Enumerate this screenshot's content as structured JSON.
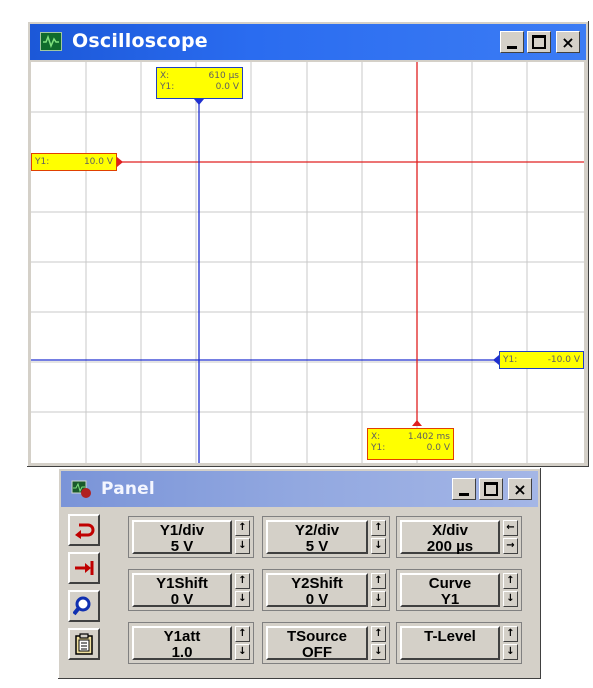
{
  "oscilloscope": {
    "title": "Oscilloscope",
    "controls": {
      "minimize": "_",
      "maximize": "□",
      "close": "×"
    },
    "cursor1": {
      "x_label": "X:",
      "x_value": "610 µs",
      "y_label": "Y1:",
      "y_value": "0.0 V"
    },
    "cursor2": {
      "x_label": "X:",
      "x_value": "1.402 ms",
      "y_label": "Y1:",
      "y_value": "0.0 V"
    },
    "hline_top": {
      "label": "Y1:",
      "value": "10.0 V"
    },
    "hline_bottom": {
      "label": "Y1:",
      "value": "-10.0 V"
    },
    "colors": {
      "grid": "#c0c0c0",
      "blue_line": "#2030d0",
      "red_line": "#e02020",
      "label_bg": "#ffff00"
    }
  },
  "panel": {
    "title": "Panel",
    "controls": {
      "minimize": "_",
      "maximize": "□",
      "close": "×"
    },
    "tools": [
      {
        "name": "loop-icon",
        "glyph": "↺"
      },
      {
        "name": "step-icon",
        "glyph": "→|"
      },
      {
        "name": "zoom-icon",
        "glyph": "🔍"
      },
      {
        "name": "clipboard-icon",
        "glyph": "📋"
      }
    ],
    "knobs": [
      {
        "label": "Y1/div",
        "value": "5 V",
        "spin_up": "↑",
        "spin_down": "↓"
      },
      {
        "label": "Y2/div",
        "value": "5 V",
        "spin_up": "↑",
        "spin_down": "↓"
      },
      {
        "label": "X/div",
        "value": "200 µs",
        "spin_up": "←",
        "spin_down": "→"
      },
      {
        "label": "Y1Shift",
        "value": "0 V",
        "spin_up": "↑",
        "spin_down": "↓"
      },
      {
        "label": "Y2Shift",
        "value": "0 V",
        "spin_up": "↑",
        "spin_down": "↓"
      },
      {
        "label": "Curve",
        "value": "Y1",
        "spin_up": "↑",
        "spin_down": "↓"
      },
      {
        "label": "Y1att",
        "value": "1.0",
        "spin_up": "↑",
        "spin_down": "↓"
      },
      {
        "label": "TSource",
        "value": "OFF",
        "spin_up": "↑",
        "spin_down": "↓"
      },
      {
        "label": "T-Level",
        "value": "",
        "spin_up": "↑",
        "spin_down": "↓"
      }
    ]
  }
}
